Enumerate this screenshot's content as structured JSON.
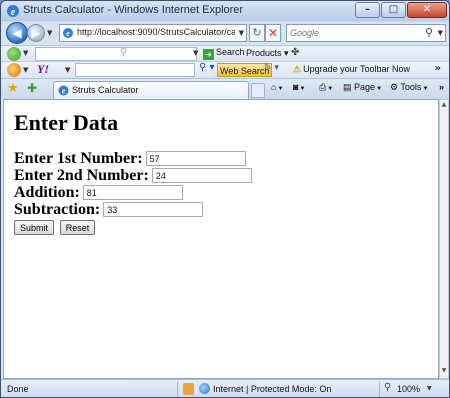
{
  "window": {
    "title": "Struts Calculator - Windows Internet Explorer",
    "min_glyph": "–",
    "max_glyph": "□",
    "close_glyph": "✕"
  },
  "navigation": {
    "back_glyph": "◀",
    "forward_glyph": "▶",
    "address": "http://localhost:9090/StrutsCalculator/calc.c",
    "refresh_glyph": "↻",
    "stop_glyph": "✕",
    "search_placeholder": "Google"
  },
  "toolbar1": {
    "search_label": "Search",
    "products_label": "Products"
  },
  "toolbar2": {
    "web_search_label": "Web Search",
    "upgrade_label": "Upgrade your Toolbar Now",
    "more_glyph": "»"
  },
  "tabs": {
    "active_tab_label": "Struts Calculator"
  },
  "commands": {
    "page_label": "Page",
    "tools_label": "Tools",
    "more_glyph": "»"
  },
  "page": {
    "heading": "Enter Data",
    "fields": [
      {
        "label": "Enter 1st Number:",
        "value": "57"
      },
      {
        "label": "Enter 2nd Number:",
        "value": "24"
      },
      {
        "label": "Addition:",
        "value": "81"
      },
      {
        "label": "Subtraction:",
        "value": "33"
      }
    ],
    "submit_label": "Submit",
    "reset_label": "Reset"
  },
  "status": {
    "text": "Done",
    "zone": "Internet | Protected Mode: On",
    "zoom": "100%"
  },
  "colors": {
    "frame": "#b9cbe4",
    "close_button": "#c5452c",
    "web_search_button": "#f3bd45",
    "content_background": "#ffffff"
  }
}
